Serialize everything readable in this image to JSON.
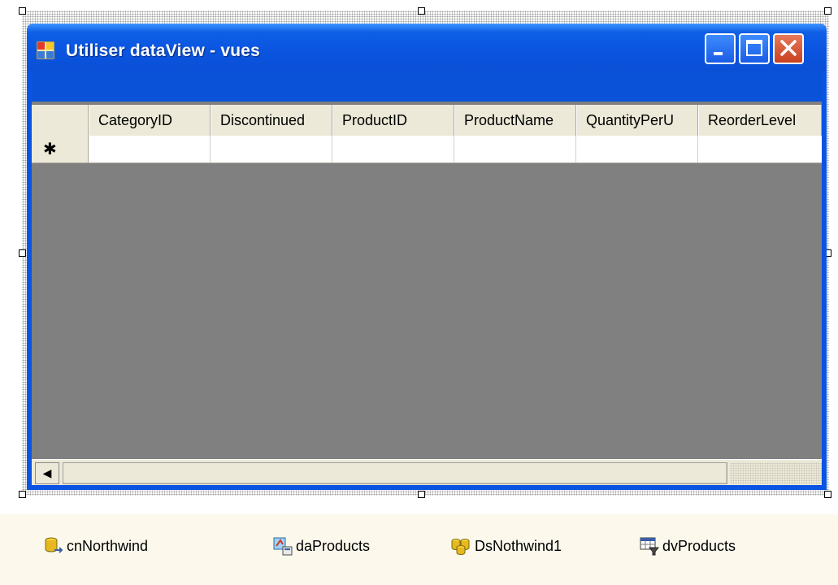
{
  "window": {
    "title": "Utiliser dataView - vues"
  },
  "grid": {
    "columns": [
      "CategoryID",
      "Discontinued",
      "ProductID",
      "ProductName",
      "QuantityPerU",
      "ReorderLevel"
    ],
    "new_row_marker": "✱",
    "scroll_left_arrow": "◀"
  },
  "tray": {
    "components": [
      {
        "name": "cnNorthwind",
        "icon": "database-connection-icon"
      },
      {
        "name": "daProducts",
        "icon": "data-adapter-icon"
      },
      {
        "name": "DsNothwind1",
        "icon": "dataset-icon"
      },
      {
        "name": "dvProducts",
        "icon": "dataview-icon"
      }
    ]
  },
  "colors": {
    "title_blue": "#0a54e3",
    "grid_background": "#808080",
    "header_bg": "#ece9d8",
    "close_button": "#c8401f",
    "tray_bg": "#fcf9ec"
  }
}
